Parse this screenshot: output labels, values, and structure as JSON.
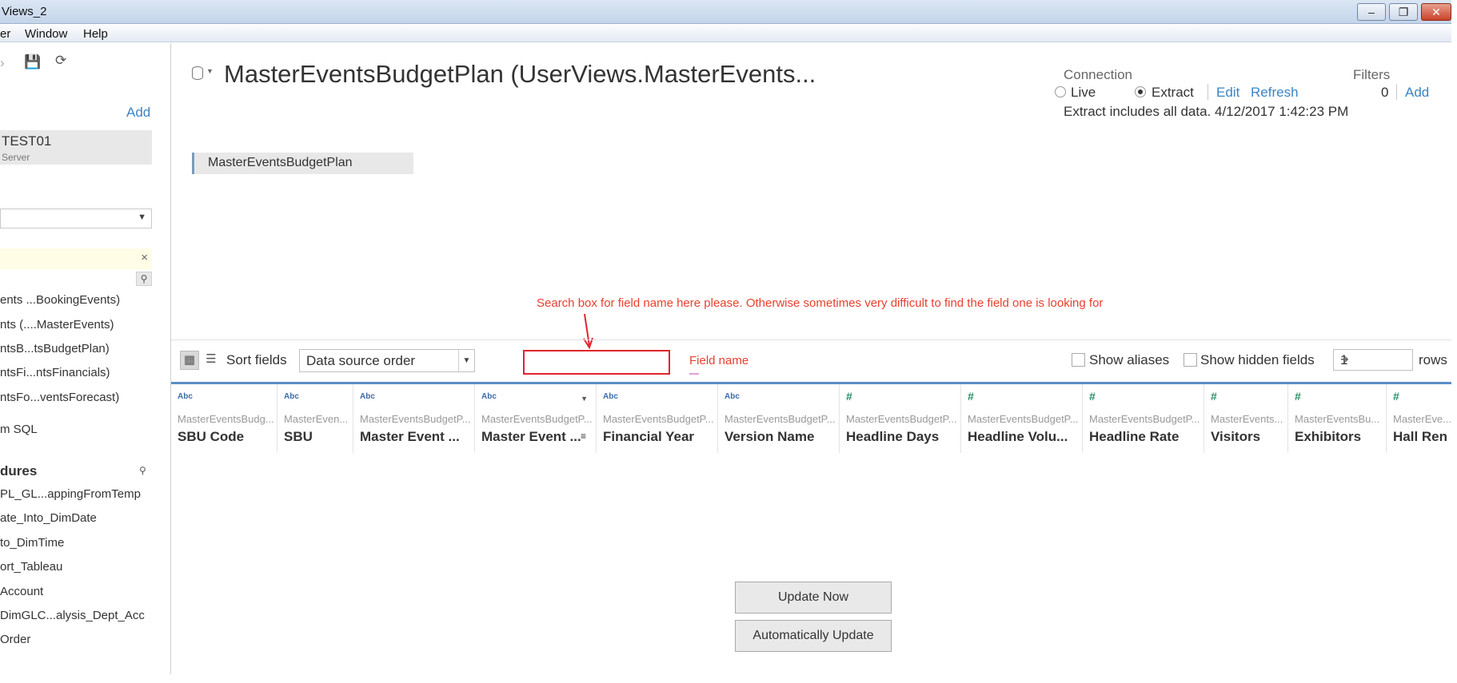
{
  "window": {
    "title": "Views_2"
  },
  "menu": {
    "items": [
      "er",
      "Window",
      "Help"
    ]
  },
  "sidebar": {
    "add_label": "Add",
    "connection_name": "TEST01",
    "connection_type": "Server",
    "tables": [
      "ents ...BookingEvents)",
      "nts (....MasterEvents)",
      "ntsB...tsBudgetPlan)",
      "ntsFi...ntsFinancials)",
      "ntsFo...ventsForecast)"
    ],
    "custom_sql": "m SQL",
    "procedures_heading": "dures",
    "procedures": [
      "PL_GL...appingFromTemp",
      "ate_Into_DimDate",
      "to_DimTime",
      "ort_Tableau",
      "Account",
      "DimGLC...alysis_Dept_Acc",
      "Order"
    ]
  },
  "header": {
    "title": "MasterEventsBudgetPlan (UserViews.MasterEvents...",
    "connection_label": "Connection",
    "live_label": "Live",
    "extract_label": "Extract",
    "connection_mode": "Extract",
    "edit_label": "Edit",
    "refresh_label": "Refresh",
    "extract_info": "Extract includes all data. 4/12/2017 1:42:23 PM",
    "filters_label": "Filters",
    "filters_count": "0",
    "filters_add": "Add"
  },
  "canvas": {
    "table_name": "MasterEventsBudgetPlan"
  },
  "annotation": {
    "text": "Search box for field name here please. Otherwise sometimes very difficult to find the field one is looking for",
    "field_label": "Field name",
    "color": "#e8402f"
  },
  "toolbar": {
    "sort_label": "Sort fields",
    "sort_value": "Data source order",
    "show_aliases": "Show aliases",
    "show_hidden": "Show hidden fields",
    "rows_value": "1",
    "rows_label": "rows"
  },
  "columns": [
    {
      "type": "Abc",
      "source": "MasterEventsBudg...",
      "name": "SBU Code"
    },
    {
      "type": "Abc",
      "source": "MasterEven...",
      "name": "SBU"
    },
    {
      "type": "Abc",
      "source": "MasterEventsBudgetP...",
      "name": "Master Event ..."
    },
    {
      "type": "Abc",
      "source": "MasterEventsBudgetP...",
      "name": "Master Event ..."
    },
    {
      "type": "Abc",
      "source": "MasterEventsBudgetP...",
      "name": "Financial Year"
    },
    {
      "type": "Abc",
      "source": "MasterEventsBudgetP...",
      "name": "Version Name"
    },
    {
      "type": "#",
      "source": "MasterEventsBudgetP...",
      "name": "Headline Days"
    },
    {
      "type": "#",
      "source": "MasterEventsBudgetP...",
      "name": "Headline Volu..."
    },
    {
      "type": "#",
      "source": "MasterEventsBudgetP...",
      "name": "Headline Rate"
    },
    {
      "type": "#",
      "source": "MasterEvents...",
      "name": "Visitors"
    },
    {
      "type": "#",
      "source": "MasterEventsBu...",
      "name": "Exhibitors"
    },
    {
      "type": "#",
      "source": "MasterEve...",
      "name": "Hall Ren"
    }
  ],
  "buttons": {
    "update_now": "Update Now",
    "auto_update": "Automatically Update"
  }
}
